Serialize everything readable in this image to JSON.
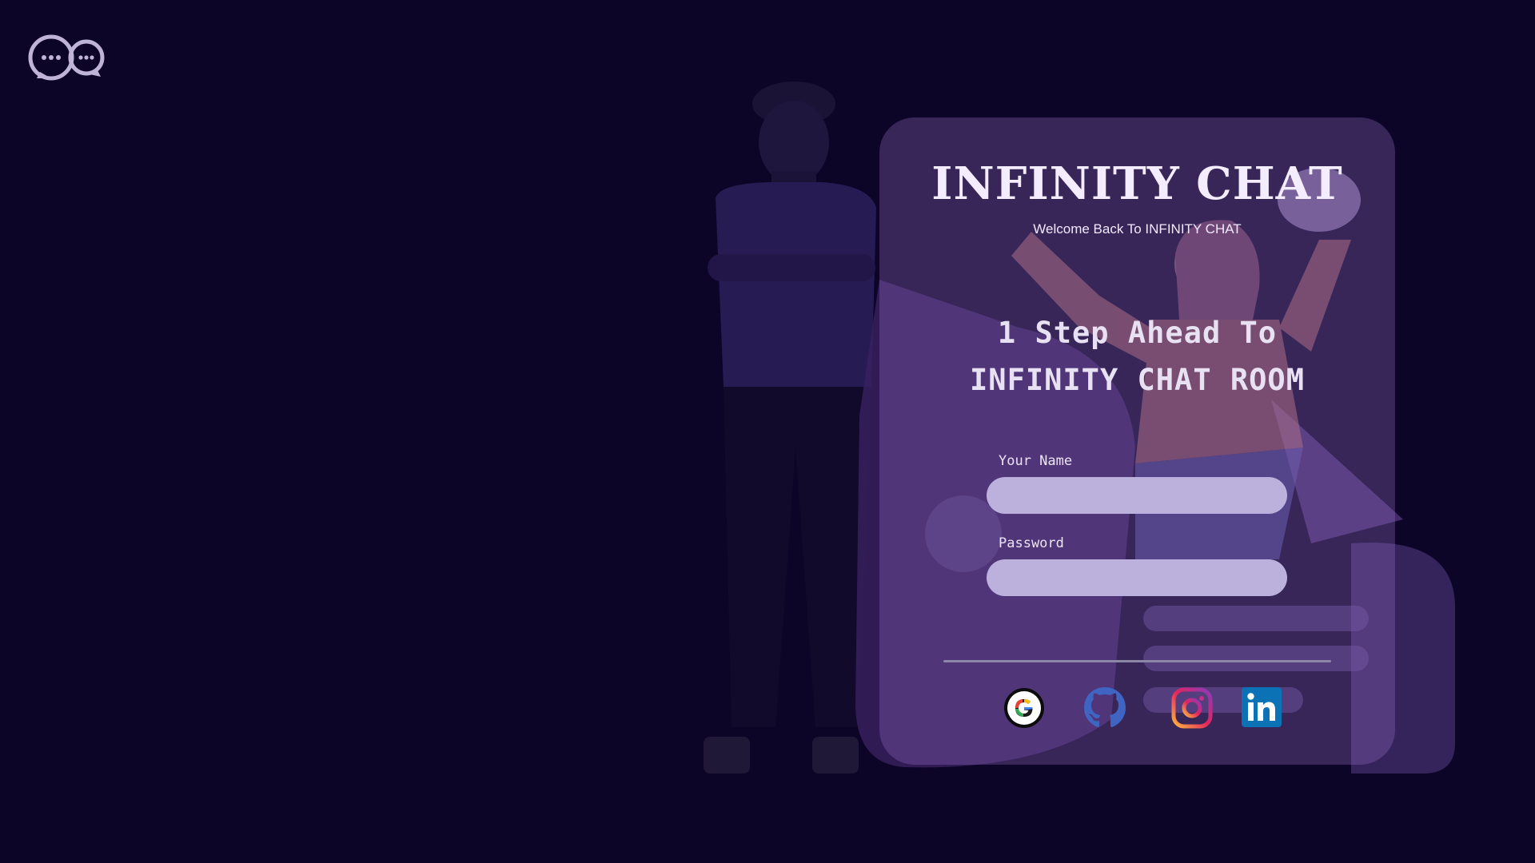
{
  "app": {
    "title": "INFINITY CHAT",
    "subtitle": "Welcome Back To INFINITY CHAT"
  },
  "headline": {
    "line1": "1 Step Ahead To",
    "line2": "INFINITY CHAT ROOM"
  },
  "form": {
    "name_label": "Your Name",
    "name_value": "",
    "password_label": "Password",
    "password_value": ""
  },
  "social": [
    {
      "icon": "google-icon"
    },
    {
      "icon": "github-icon"
    },
    {
      "icon": "instagram-icon"
    },
    {
      "icon": "linkedin-icon"
    }
  ],
  "colors": {
    "background": "#0c0527",
    "card": "#5b3f80",
    "input": "#bcb1dd",
    "text": "#f4ecff"
  }
}
